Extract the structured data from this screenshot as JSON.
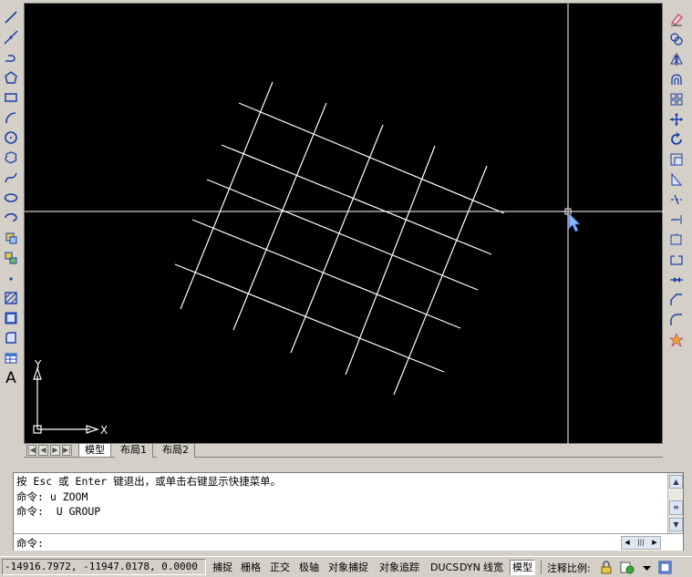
{
  "left_toolbar": {
    "icons": [
      "line-icon",
      "construction-line-icon",
      "polyline-icon",
      "polygon-icon",
      "rectangle-icon",
      "arc-icon",
      "circle-icon",
      "revision-cloud-icon",
      "spline-icon",
      "ellipse-icon",
      "ellipse-arc-icon",
      "insert-block-icon",
      "make-block-icon",
      "point-icon",
      "hatch-icon",
      "gradient-icon",
      "region-icon",
      "table-icon"
    ],
    "text_tool_label": "A"
  },
  "right_toolbar": {
    "icons": [
      "erase-icon",
      "copy-icon",
      "mirror-icon",
      "offset-icon",
      "array-icon",
      "move-icon",
      "rotate-icon",
      "scale-icon",
      "stretch-icon",
      "trim-icon",
      "extend-icon",
      "break-at-point-icon",
      "break-icon",
      "join-icon",
      "chamfer-icon",
      "fillet-icon",
      "explode-icon"
    ]
  },
  "ucs": {
    "x_label": "X",
    "y_label": "Y"
  },
  "layout_tabs": [
    {
      "label": "模型",
      "active": true
    },
    {
      "label": "布局1",
      "active": false
    },
    {
      "label": "布局2",
      "active": false
    }
  ],
  "command_history": [
    "按 Esc 或 Enter 键退出，或单击右键显示快捷菜单。",
    "命令: u ZOOM",
    "命令:  U GROUP"
  ],
  "command_prompt": {
    "label": "命令:",
    "value": ""
  },
  "status_bar": {
    "coordinates": "-14916.7972, -11947.0178, 0.0000",
    "toggles": [
      {
        "label": "捕捉",
        "pressed": false
      },
      {
        "label": "栅格",
        "pressed": false
      },
      {
        "label": "正交",
        "pressed": false
      },
      {
        "label": "极轴",
        "pressed": false
      },
      {
        "label": "对象捕捉",
        "pressed": false
      },
      {
        "label": "对象追踪",
        "pressed": false
      },
      {
        "label": "DUCS",
        "pressed": false
      },
      {
        "label": "DYN",
        "pressed": false
      },
      {
        "label": "线宽",
        "pressed": false
      },
      {
        "label": "模型",
        "pressed": true
      }
    ],
    "annotation_scale_label": "注释比例:"
  },
  "colors": {
    "canvas_background": "#000000",
    "drawing_lines": "#ffffff",
    "chrome": "#d4d0c8",
    "cursor": "#8ab4ff"
  }
}
